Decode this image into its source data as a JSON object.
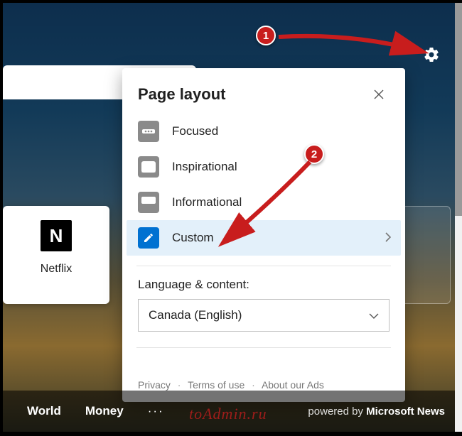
{
  "gear": {
    "name": "settings-gear"
  },
  "popup": {
    "title": "Page layout",
    "close_label": "Close",
    "options": [
      {
        "label": "Focused",
        "icon": "focused-icon"
      },
      {
        "label": "Inspirational",
        "icon": "inspirational-icon"
      },
      {
        "label": "Informational",
        "icon": "informational-icon"
      },
      {
        "label": "Custom",
        "icon": "custom-icon",
        "selected": true
      }
    ],
    "language_label": "Language & content:",
    "language_selected": "Canada (English)",
    "footer": {
      "privacy": "Privacy",
      "terms": "Terms of use",
      "ads": "About our Ads"
    }
  },
  "tile": {
    "icon_letter": "N",
    "label": "Netflix"
  },
  "nav": {
    "world": "World",
    "money": "Money",
    "more": "···",
    "powered_prefix": "powered by ",
    "powered_brand": "Microsoft News"
  },
  "annotations": {
    "step1": "1",
    "step2": "2"
  },
  "watermark": "toAdmin.ru"
}
